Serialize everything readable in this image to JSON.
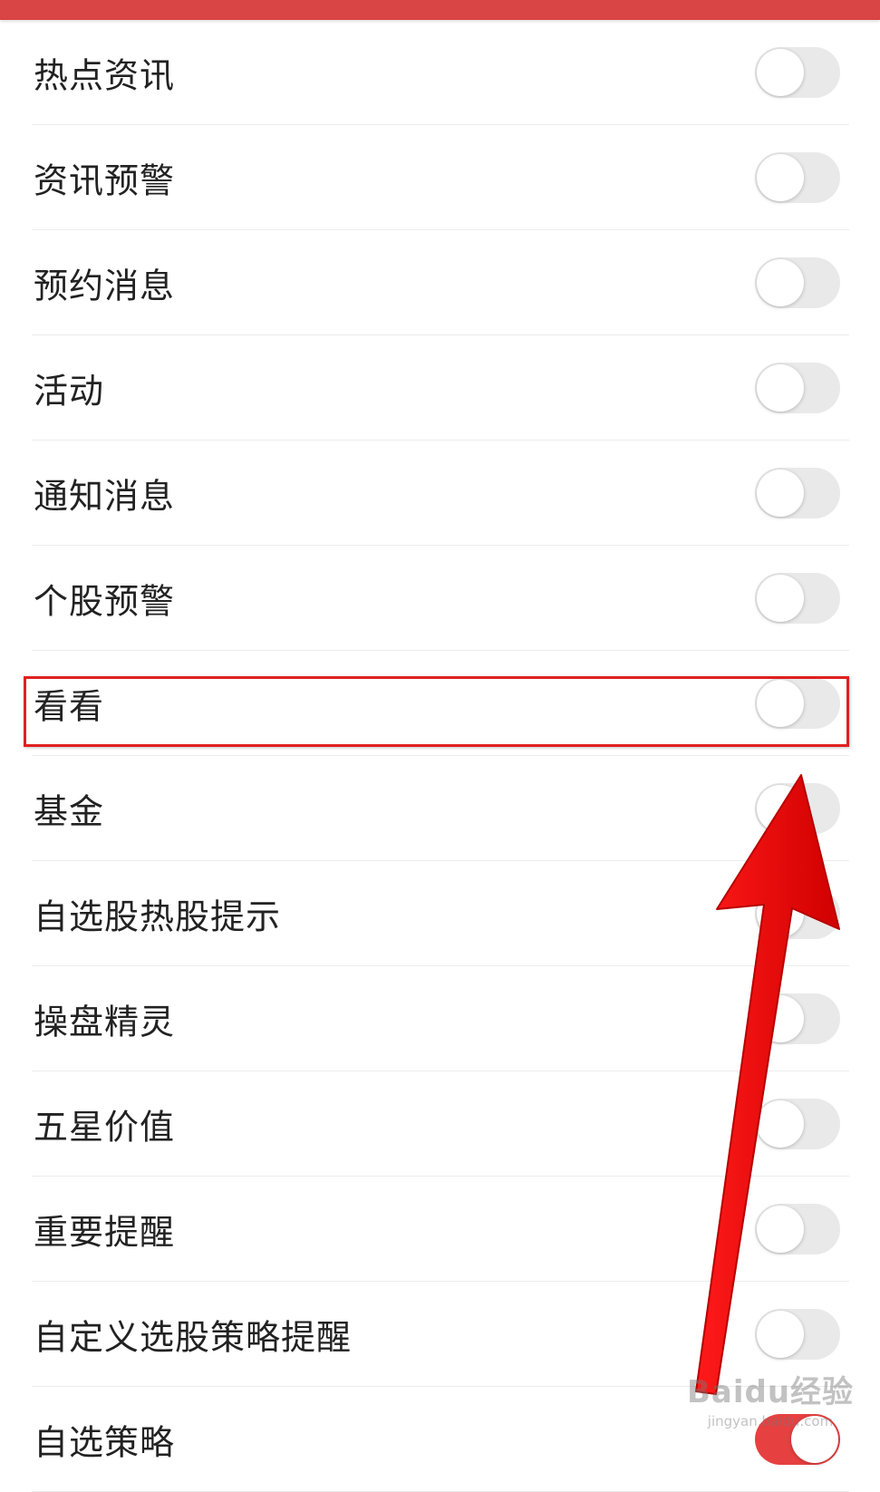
{
  "header": {
    "color": "#d94444"
  },
  "settings": {
    "items": [
      {
        "label": "热点资讯",
        "on": false
      },
      {
        "label": "资讯预警",
        "on": false
      },
      {
        "label": "预约消息",
        "on": false
      },
      {
        "label": "活动",
        "on": false
      },
      {
        "label": "通知消息",
        "on": false
      },
      {
        "label": "个股预警",
        "on": false
      },
      {
        "label": "看看",
        "on": false
      },
      {
        "label": "基金",
        "on": false
      },
      {
        "label": "自选股热股提示",
        "on": false
      },
      {
        "label": "操盘精灵",
        "on": false
      },
      {
        "label": "五星价值",
        "on": false
      },
      {
        "label": "重要提醒",
        "on": false
      },
      {
        "label": "自定义选股策略提醒",
        "on": false
      },
      {
        "label": "自选策略",
        "on": true
      }
    ]
  },
  "annotation": {
    "highlighted_item": "看看",
    "arrow_color": "#ff0000",
    "box_color": "#e02020"
  },
  "watermark": {
    "logo": "Baidu经验",
    "url": "jingyan.baidu.com"
  }
}
